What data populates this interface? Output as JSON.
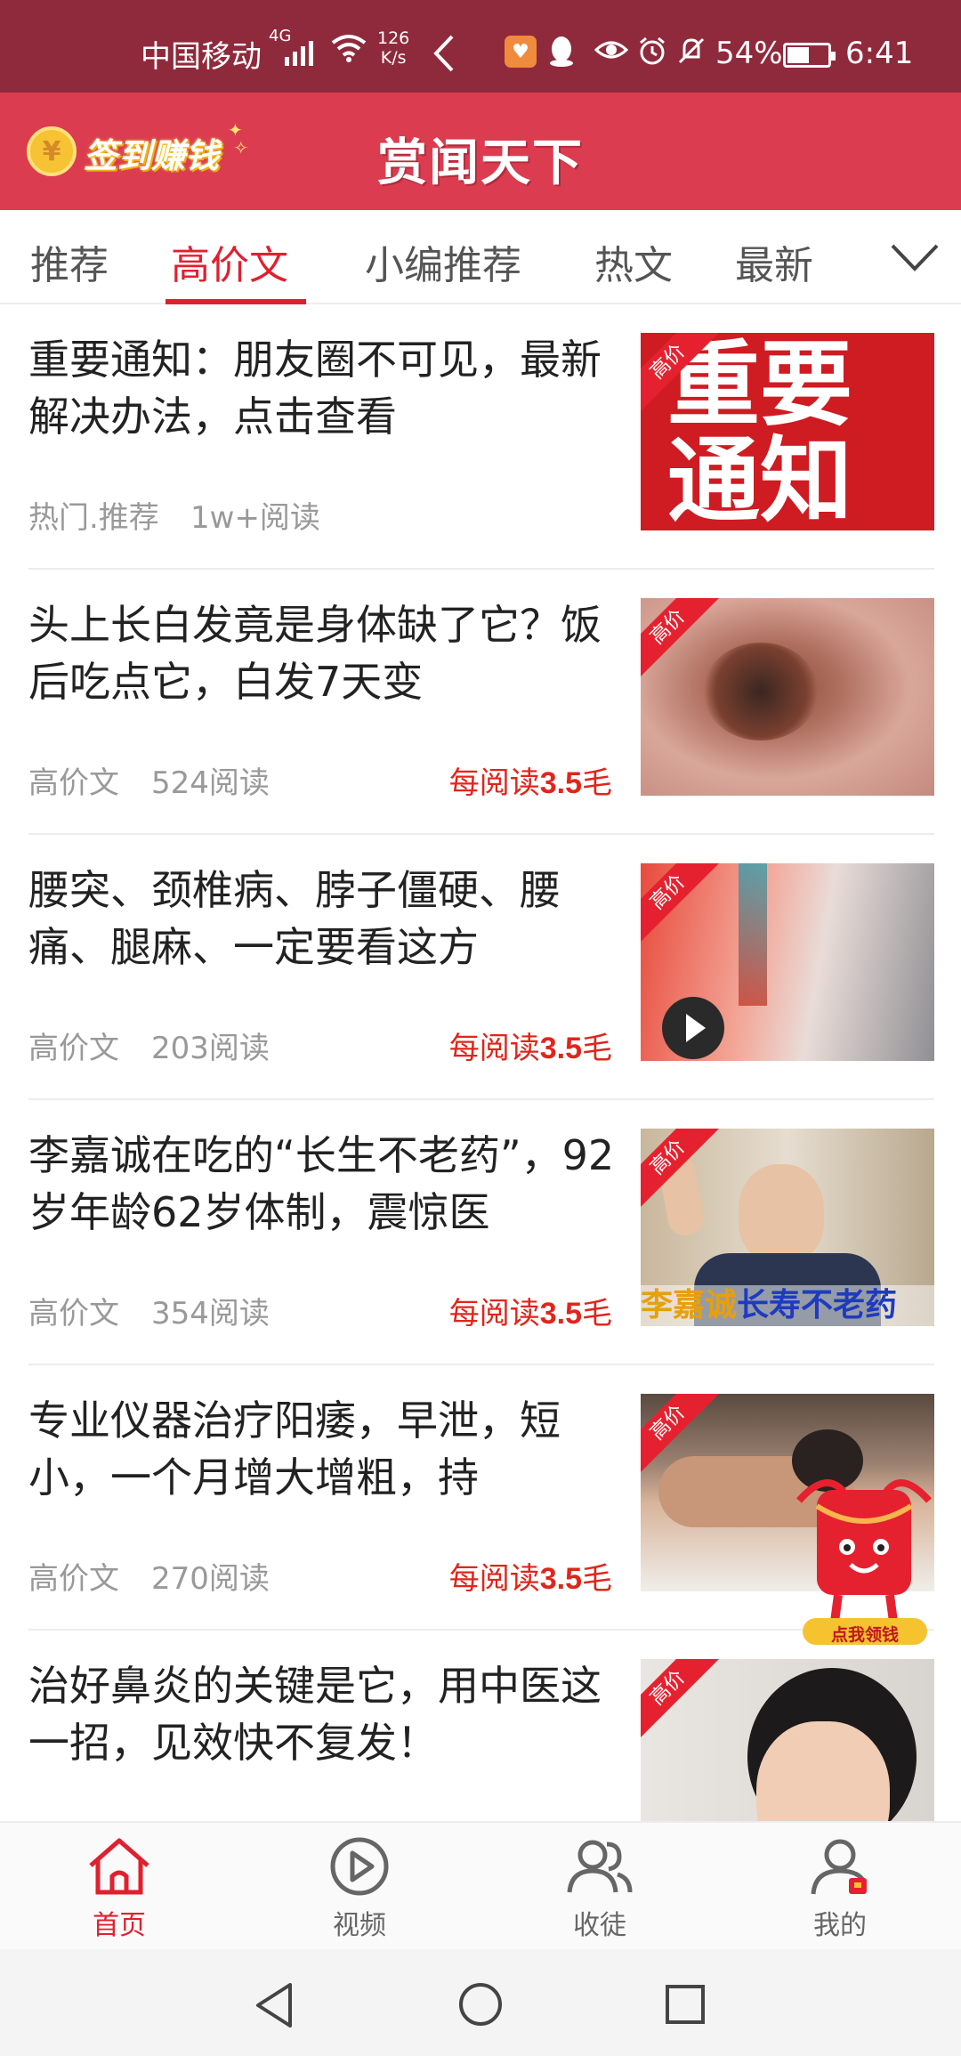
{
  "status_bar": {
    "carrier": "中国移动",
    "network": "4G",
    "speed_value": "126",
    "speed_unit": "K/s",
    "battery": "54%",
    "battery_level": 0.54,
    "time": "6:41"
  },
  "header": {
    "checkin_coin": "¥",
    "checkin_label": "签到赚钱",
    "app_title": "赏闻天下"
  },
  "tabs": [
    {
      "label": "推荐",
      "active": false
    },
    {
      "label": "高价文",
      "active": true
    },
    {
      "label": "小编推荐",
      "active": false
    },
    {
      "label": "热文",
      "active": false
    },
    {
      "label": "最新",
      "active": false
    }
  ],
  "ribbon_label": "高价",
  "articles": [
    {
      "title": "重要通知：朋友圈不可见，最新解决办法，点击查看",
      "category": "热门.推荐",
      "reads": "1w+阅读",
      "reward_prefix": "",
      "reward_value": "",
      "reward_suffix": "",
      "thumb_text_1": "重要",
      "thumb_text_2": "通知"
    },
    {
      "title": "头上长白发竟是身体缺了它？饭后吃点它，白发7天变",
      "category": "高价文",
      "reads": "524阅读",
      "reward_prefix": "每阅读",
      "reward_value": "3.5",
      "reward_suffix": "毛"
    },
    {
      "title": "腰突、颈椎病、脖子僵硬、腰痛、腿麻、一定要看这方",
      "category": "高价文",
      "reads": "203阅读",
      "reward_prefix": "每阅读",
      "reward_value": "3.5",
      "reward_suffix": "毛"
    },
    {
      "title": "李嘉诚在吃的“长生不老药”，92岁年龄62岁体制，震惊医",
      "category": "高价文",
      "reads": "354阅读",
      "reward_prefix": "每阅读",
      "reward_value": "3.5",
      "reward_suffix": "毛",
      "thumb_caption_1": "李嘉诚",
      "thumb_caption_2": "长寿不老药"
    },
    {
      "title": "专业仪器治疗阳痿，早泄，短小，一个月增大增粗，持",
      "category": "高价文",
      "reads": "270阅读",
      "reward_prefix": "每阅读",
      "reward_value": "3.5",
      "reward_suffix": "毛"
    },
    {
      "title": "治好鼻炎的关键是它，用中医这一招，见效快不复发！",
      "category": "",
      "reads": "",
      "reward_prefix": "",
      "reward_value": "",
      "reward_suffix": ""
    }
  ],
  "float_packet": {
    "label": "点我领钱"
  },
  "bottom_nav": [
    {
      "label": "首页",
      "icon": "home-icon",
      "active": true
    },
    {
      "label": "视频",
      "icon": "video-play-icon",
      "active": false
    },
    {
      "label": "收徒",
      "icon": "users-icon",
      "active": false
    },
    {
      "label": "我的",
      "icon": "profile-icon",
      "active": false
    }
  ],
  "colors": {
    "status_bar": "#8f2a3c",
    "header": "#db3c4f",
    "accent": "#e0202f",
    "reward": "#e1251b",
    "meta_text": "#999999"
  }
}
